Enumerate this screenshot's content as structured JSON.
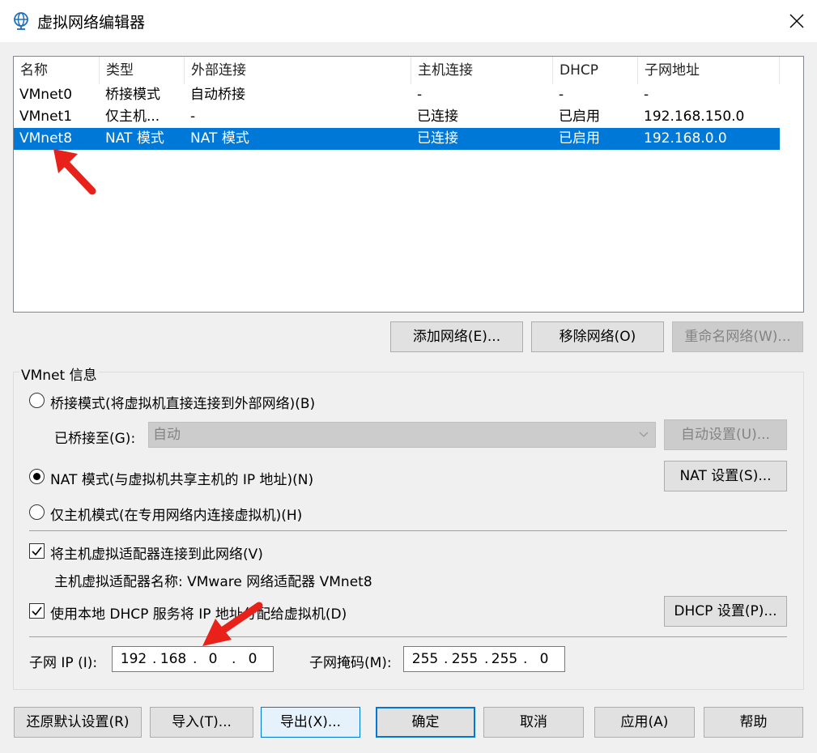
{
  "window": {
    "title": "虚拟网络编辑器",
    "icon": "globe-icon"
  },
  "network_table": {
    "columns": [
      "名称",
      "类型",
      "外部连接",
      "主机连接",
      "DHCP",
      "子网地址"
    ],
    "rows": [
      {
        "name": "VMnet0",
        "type": "桥接模式",
        "external": "自动桥接",
        "host": "-",
        "dhcp": "-",
        "subnet": "-"
      },
      {
        "name": "VMnet1",
        "type": "仅主机...",
        "external": "-",
        "host": "已连接",
        "dhcp": "已启用",
        "subnet": "192.168.150.0"
      },
      {
        "name": "VMnet8",
        "type": "NAT 模式",
        "external": "NAT 模式",
        "host": "已连接",
        "dhcp": "已启用",
        "subnet": "192.168.0.0"
      }
    ],
    "selected_row": "VMnet8"
  },
  "list_buttons": {
    "add": "添加网络(E)...",
    "remove": "移除网络(O)",
    "rename": "重命名网络(W)..."
  },
  "vmnet_info": {
    "group_title": "VMnet 信息",
    "bridged_label": "桥接模式(将虚拟机直接连接到外部网络)(B)",
    "bridged_to_label": "已桥接至(G):",
    "bridged_to_value": "自动",
    "auto_settings": "自动设置(U)...",
    "nat_label": "NAT 模式(与虚拟机共享主机的 IP 地址)(N)",
    "nat_settings": "NAT 设置(S)...",
    "hostonly_label": "仅主机模式(在专用网络内连接虚拟机)(H)",
    "selected_mode": "nat",
    "connect_adapter_label": "将主机虚拟适配器连接到此网络(V)",
    "connect_adapter_checked": true,
    "adapter_name_text": "主机虚拟适配器名称: VMware 网络适配器 VMnet8",
    "dhcp_label": "使用本地 DHCP 服务将 IP 地址分配给虚拟机(D)",
    "dhcp_checked": true,
    "dhcp_settings": "DHCP 设置(P)...",
    "subnet_ip_label": "子网 IP (I):",
    "subnet_ip": [
      "192",
      "168",
      "0",
      "0"
    ],
    "subnet_mask_label": "子网掩码(M):",
    "subnet_mask": [
      "255",
      "255",
      "255",
      "0"
    ]
  },
  "footer_buttons": {
    "restore": "还原默认设置(R)",
    "import": "导入(T)...",
    "export": "导出(X)...",
    "ok": "确定",
    "cancel": "取消",
    "apply": "应用(A)",
    "help": "帮助"
  },
  "colors": {
    "selection": "#0078d7",
    "annotation_arrow": "#e8221b"
  }
}
